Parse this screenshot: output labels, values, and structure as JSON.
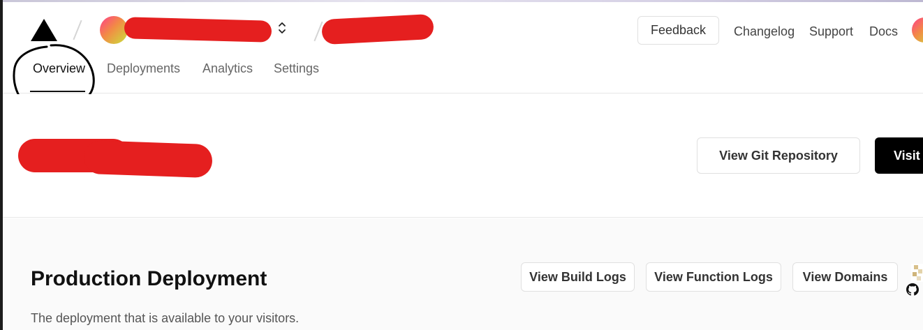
{
  "header": {
    "tabs": [
      {
        "label": "Overview",
        "active": true
      },
      {
        "label": "Deployments",
        "active": false
      },
      {
        "label": "Analytics",
        "active": false
      },
      {
        "label": "Settings",
        "active": false
      }
    ],
    "feedback_label": "Feedback",
    "nav_links": [
      "Changelog",
      "Support",
      "Docs"
    ]
  },
  "project": {
    "view_git_label": "View Git Repository",
    "visit_label": "Visit"
  },
  "production": {
    "title": "Production Deployment",
    "description": "The deployment that is available to your visitors.",
    "buttons": [
      "View Build Logs",
      "View Function Logs",
      "View Domains"
    ]
  },
  "icons": {
    "logo": "triangle-logo-icon",
    "switcher": "chevron-up-down-icon",
    "github": "github-icon"
  },
  "colors": {
    "accent": "#000000",
    "redaction": "#e51f1f",
    "avatar_gradient": [
      "#ff3d8b",
      "#f28b45",
      "#c9e23b"
    ]
  }
}
